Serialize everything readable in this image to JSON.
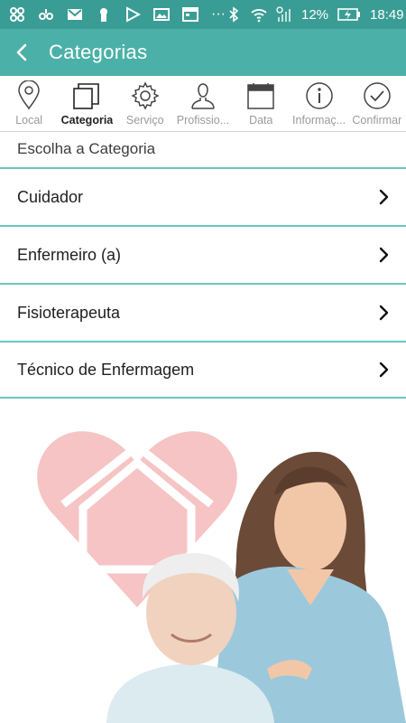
{
  "status_bar": {
    "battery": "12%",
    "time": "18:49",
    "dots": "···"
  },
  "app_bar": {
    "title": "Categorias"
  },
  "steps": [
    {
      "label": "Local",
      "icon": "location-pin-icon",
      "active": false
    },
    {
      "label": "Categoria",
      "icon": "categories-icon",
      "active": true
    },
    {
      "label": "Serviço",
      "icon": "gear-icon",
      "active": false
    },
    {
      "label": "Profissio...",
      "icon": "person-icon",
      "active": false
    },
    {
      "label": "Data",
      "icon": "calendar-icon",
      "active": false
    },
    {
      "label": "Informaç...",
      "icon": "info-icon",
      "active": false
    },
    {
      "label": "Confirmar",
      "icon": "check-circle-icon",
      "active": false
    }
  ],
  "section": {
    "title": "Escolha a Categoria"
  },
  "categories": [
    {
      "label": "Cuidador"
    },
    {
      "label": "Enfermeiro (a)"
    },
    {
      "label": "Fisioterapeuta"
    },
    {
      "label": "Técnico de Enfermagem"
    }
  ],
  "colors": {
    "status_bar": "#3a9d95",
    "app_bar": "#4bb1a8",
    "divider": "#6cc6c0",
    "heart": "#f7c9c9"
  }
}
